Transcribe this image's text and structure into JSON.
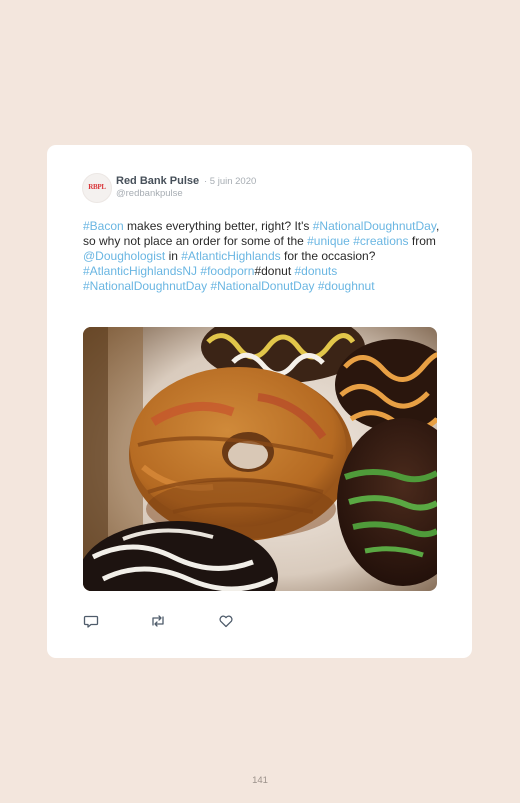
{
  "tweet": {
    "avatar_text": "RBPL",
    "author_name": "Red Bank Pulse",
    "date": "· 5 juin 2020",
    "handle": "@redbankpulse",
    "text_segments": [
      {
        "text": "#Bacon",
        "link": true
      },
      {
        "text": " makes everything better, right? It's ",
        "link": false
      },
      {
        "text": "#NationalDoughnutDay",
        "link": true
      },
      {
        "text": ", so why not place an order for some of the ",
        "link": false
      },
      {
        "text": "#unique",
        "link": true
      },
      {
        "text": " ",
        "link": false
      },
      {
        "text": "#creations",
        "link": true
      },
      {
        "text": " from ",
        "link": false
      },
      {
        "text": "@Doughologist",
        "link": true
      },
      {
        "text": " in ",
        "link": false
      },
      {
        "text": "#AtlanticHighlands",
        "link": true
      },
      {
        "text": " for the occasion? ",
        "link": false
      },
      {
        "text": "#AtlanticHighlandsNJ",
        "link": true
      },
      {
        "text": " ",
        "link": false
      },
      {
        "text": "#foodporn",
        "link": true
      },
      {
        "text": "#donut ",
        "link": false
      },
      {
        "text": "#donuts",
        "link": true
      },
      {
        "text": " ",
        "link": false
      },
      {
        "text": "#NationalDoughnutDay",
        "link": true
      },
      {
        "text": " ",
        "link": false
      },
      {
        "text": "#NationalDonutDay",
        "link": true
      },
      {
        "text": " ",
        "link": false
      },
      {
        "text": "#doughnut",
        "link": true
      }
    ],
    "actions": [
      {
        "icon": "reply-icon"
      },
      {
        "icon": "retweet-icon"
      },
      {
        "icon": "like-icon"
      }
    ]
  },
  "colors": {
    "page_background": "#f3e6dd",
    "link": "#6ab6e2",
    "icon_stroke": "#4f5c6b"
  },
  "page_number": "141"
}
